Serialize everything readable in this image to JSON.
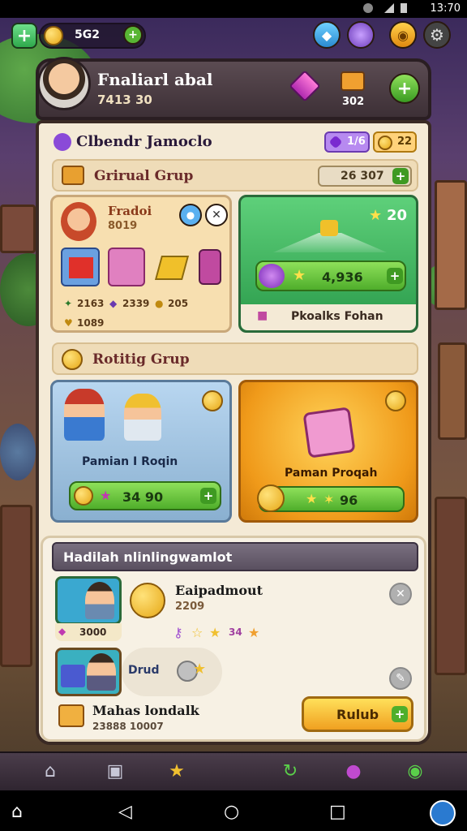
{
  "status": {
    "time": "13:70"
  },
  "hud": {
    "coins": "5G2"
  },
  "profile": {
    "name": "Fnaliarl abal",
    "level": "7413 30",
    "stars": "302"
  },
  "event": {
    "title": "Clbendr Jamoclo",
    "gems": "1/6",
    "coins": "22"
  },
  "section1": {
    "title": "Grirual Grup",
    "total": "26 307",
    "left_card": {
      "name": "Fradoi",
      "sub": "8019",
      "stat_a": "2163",
      "stat_b": "2339",
      "stat_c": "205",
      "stat_d": "1089"
    },
    "right_card": {
      "stars": "20",
      "amount": "4,936",
      "label": "Pkoalks Fohan"
    }
  },
  "section2": {
    "title": "Rotitig Grup",
    "left_card": {
      "label": "Pamian I Roqin",
      "amount": "34 90"
    },
    "right_card": {
      "label": "Paman Proqah",
      "amount": "96"
    }
  },
  "section3": {
    "title": "Hadilah nlinlingwamlot",
    "item1": {
      "name": "Eaipadmout",
      "sub": "2209",
      "count": "3000",
      "stat": "34"
    },
    "item2": {
      "name": "Drud",
      "footer_name": "Mahas londalk",
      "footer_sub": "23888 10007",
      "button": "Rulub"
    }
  }
}
